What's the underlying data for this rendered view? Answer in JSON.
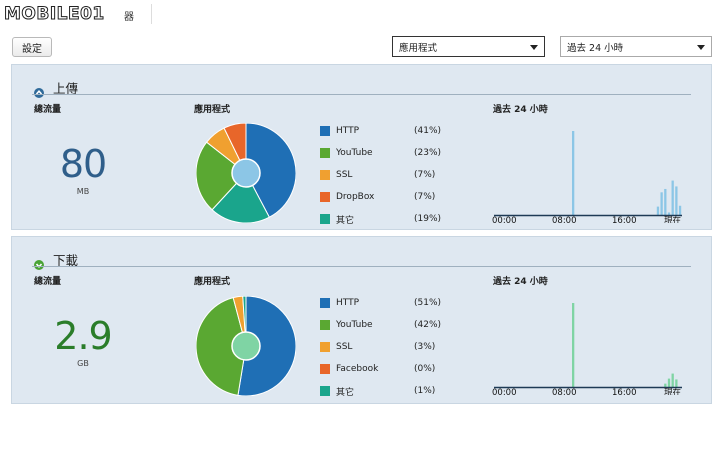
{
  "header": {
    "logo_text": "MOBILE01",
    "tab_label": "器"
  },
  "toolbar": {
    "settings_label": "設定",
    "app_select": {
      "value": "應用程式"
    },
    "time_select": {
      "value": "過去 24 小時"
    }
  },
  "upload": {
    "title": "上傳",
    "total_label": "總流量",
    "total_value": "80",
    "total_unit": "MB",
    "apps_label": "應用程式",
    "history_label": "過去 24 小時",
    "value_color": "#2f5e8a",
    "legend": [
      {
        "name": "HTTP",
        "pct": "(41%)",
        "value": 41,
        "color": "#1f6fb5"
      },
      {
        "name": "YouTube",
        "pct": "(23%)",
        "value": 23,
        "color": "#5aa832"
      },
      {
        "name": "SSL",
        "pct": "(7%)",
        "value": 7,
        "color": "#f0a030"
      },
      {
        "name": "DropBox",
        "pct": "(7%)",
        "value": 7,
        "color": "#e8662a"
      },
      {
        "name": "其它",
        "pct": "(19%)",
        "value": 19,
        "color": "#1aa58c"
      }
    ],
    "pie_order": [
      0,
      4,
      1,
      2,
      3
    ],
    "bars": [
      0,
      0,
      0,
      0,
      0,
      0,
      0,
      0,
      0,
      0,
      0,
      0,
      0,
      0,
      0,
      0,
      0,
      0,
      0,
      0,
      0,
      100,
      0,
      0,
      0,
      0,
      0,
      0,
      0,
      0,
      0,
      0,
      0,
      0,
      0,
      0,
      0,
      0,
      0,
      0,
      0,
      0,
      0,
      0,
      10,
      27,
      31,
      3,
      41,
      34,
      11
    ],
    "bar_color": "#8cc6e6",
    "x_ticks": [
      "00:00",
      "08:00",
      "16:00",
      "現在"
    ]
  },
  "download": {
    "title": "下載",
    "total_label": "總流量",
    "total_value": "2.9",
    "total_unit": "GB",
    "apps_label": "應用程式",
    "history_label": "過去 24 小時",
    "value_color": "#2a7d2a",
    "legend": [
      {
        "name": "HTTP",
        "pct": "(51%)",
        "value": 51,
        "color": "#1f6fb5"
      },
      {
        "name": "YouTube",
        "pct": "(42%)",
        "value": 42,
        "color": "#5aa832"
      },
      {
        "name": "SSL",
        "pct": "(3%)",
        "value": 3,
        "color": "#f0a030"
      },
      {
        "name": "Facebook",
        "pct": "(0%)",
        "value": 0,
        "color": "#e8662a"
      },
      {
        "name": "其它",
        "pct": "(1%)",
        "value": 1,
        "color": "#1aa58c"
      }
    ],
    "pie_order": [
      0,
      1,
      2,
      3,
      4
    ],
    "bars": [
      0,
      0,
      0,
      0,
      0,
      0,
      0,
      0,
      0,
      0,
      0,
      0,
      0,
      0,
      0,
      0,
      0,
      0,
      0,
      0,
      0,
      100,
      0,
      0,
      0,
      0,
      0,
      0,
      0,
      0,
      0,
      0,
      0,
      0,
      0,
      0,
      0,
      0,
      0,
      0,
      0,
      0,
      0,
      0,
      0,
      0,
      4,
      10,
      16,
      9,
      0
    ],
    "bar_color": "#7fd4a4",
    "x_ticks": [
      "00:00",
      "08:00",
      "16:00",
      "現在"
    ]
  }
}
